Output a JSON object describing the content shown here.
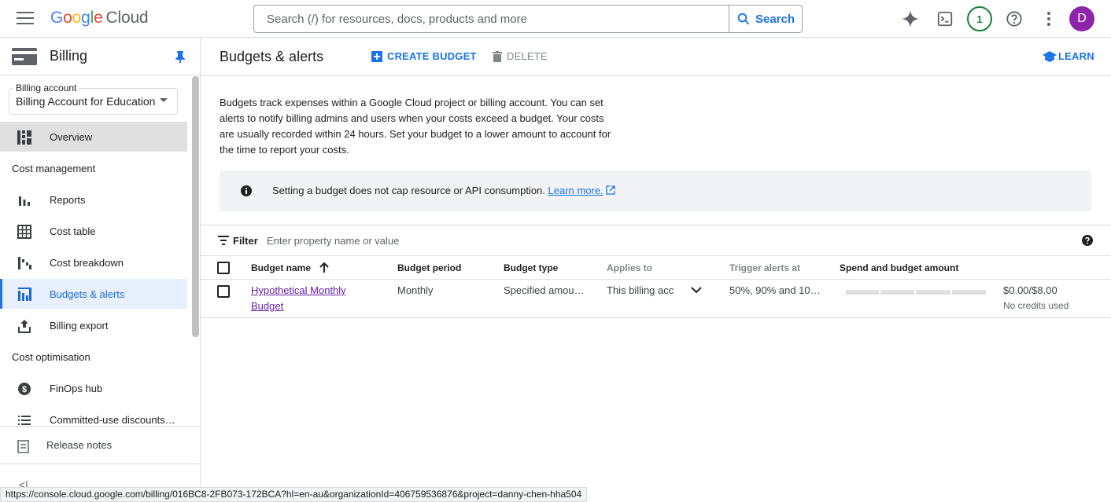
{
  "topbar": {
    "logo_letters": [
      "G",
      "o",
      "o",
      "g",
      "l",
      "e"
    ],
    "logo_product": "Cloud",
    "search_placeholder": "Search (/) for resources, docs, products and more",
    "search_button": "Search",
    "notification_count": "1",
    "avatar_letter": "D"
  },
  "sidebar": {
    "title": "Billing",
    "billing_account_label": "Billing account",
    "billing_account_value": "Billing Account for Education",
    "overview": "Overview",
    "section_cost_management": "Cost management",
    "reports": "Reports",
    "cost_table": "Cost table",
    "cost_breakdown": "Cost breakdown",
    "budgets_alerts": "Budgets & alerts",
    "billing_export": "Billing export",
    "section_cost_optimisation": "Cost optimisation",
    "finops_hub": "FinOps hub",
    "committed_use": "Committed-use discounts…",
    "release_notes": "Release notes",
    "collapse": "<|"
  },
  "main": {
    "title": "Budgets & alerts",
    "create_budget": "CREATE BUDGET",
    "delete": "DELETE",
    "learn": "LEARN",
    "intro": "Budgets track expenses within a Google Cloud project or billing account. You can set alerts to notify billing admins and users when your costs exceed a budget. Your costs are usually recorded within 24 hours. Set your budget to a lower amount to account for the time to report your costs.",
    "info_text": "Setting a budget does not cap resource or API consumption.",
    "info_link": "Learn more.",
    "filter_label": "Filter",
    "filter_placeholder": "Enter property name or value"
  },
  "table": {
    "headers": {
      "budget_name": "Budget name",
      "budget_period": "Budget period",
      "budget_type": "Budget type",
      "applies_to": "Applies to",
      "trigger_alerts": "Trigger alerts at",
      "spend_budget": "Spend and budget amount"
    },
    "rows": [
      {
        "budget_name": "Hypothetical Monthly Budget",
        "budget_period": "Monthly",
        "budget_type": "Specified amou…",
        "applies_to": "This billing acc",
        "trigger_alerts": "50%, 90% and 10…",
        "spend_fraction": 0,
        "amount": "$0.00/$8.00",
        "credits": "No credits used"
      }
    ]
  },
  "status_url": "https://console.cloud.google.com/billing/016BC8-2FB073-172BCA?hl=en-au&organizationId=406759536876&project=danny-chen-hha504",
  "colors": {
    "accent": "#1a73e8",
    "visited_link": "#681da8",
    "active_nav_bg": "#e8f0fe",
    "badge_green": "#188038",
    "avatar_purple": "#8e24aa"
  },
  "icons": [
    "menu-icon",
    "gemini-spark-icon",
    "terminal-icon",
    "help-icon",
    "more-vert-icon",
    "billing-card-icon",
    "pin-icon",
    "dashboard-icon",
    "bar-chart-icon",
    "table-icon",
    "waterfall-icon",
    "budget-icon",
    "export-icon",
    "dollar-icon",
    "list-icon",
    "notes-icon",
    "add-box-icon",
    "trash-icon",
    "school-icon",
    "info-icon",
    "external-link-icon",
    "filter-icon",
    "arrow-up-icon",
    "chevron-down-icon"
  ]
}
